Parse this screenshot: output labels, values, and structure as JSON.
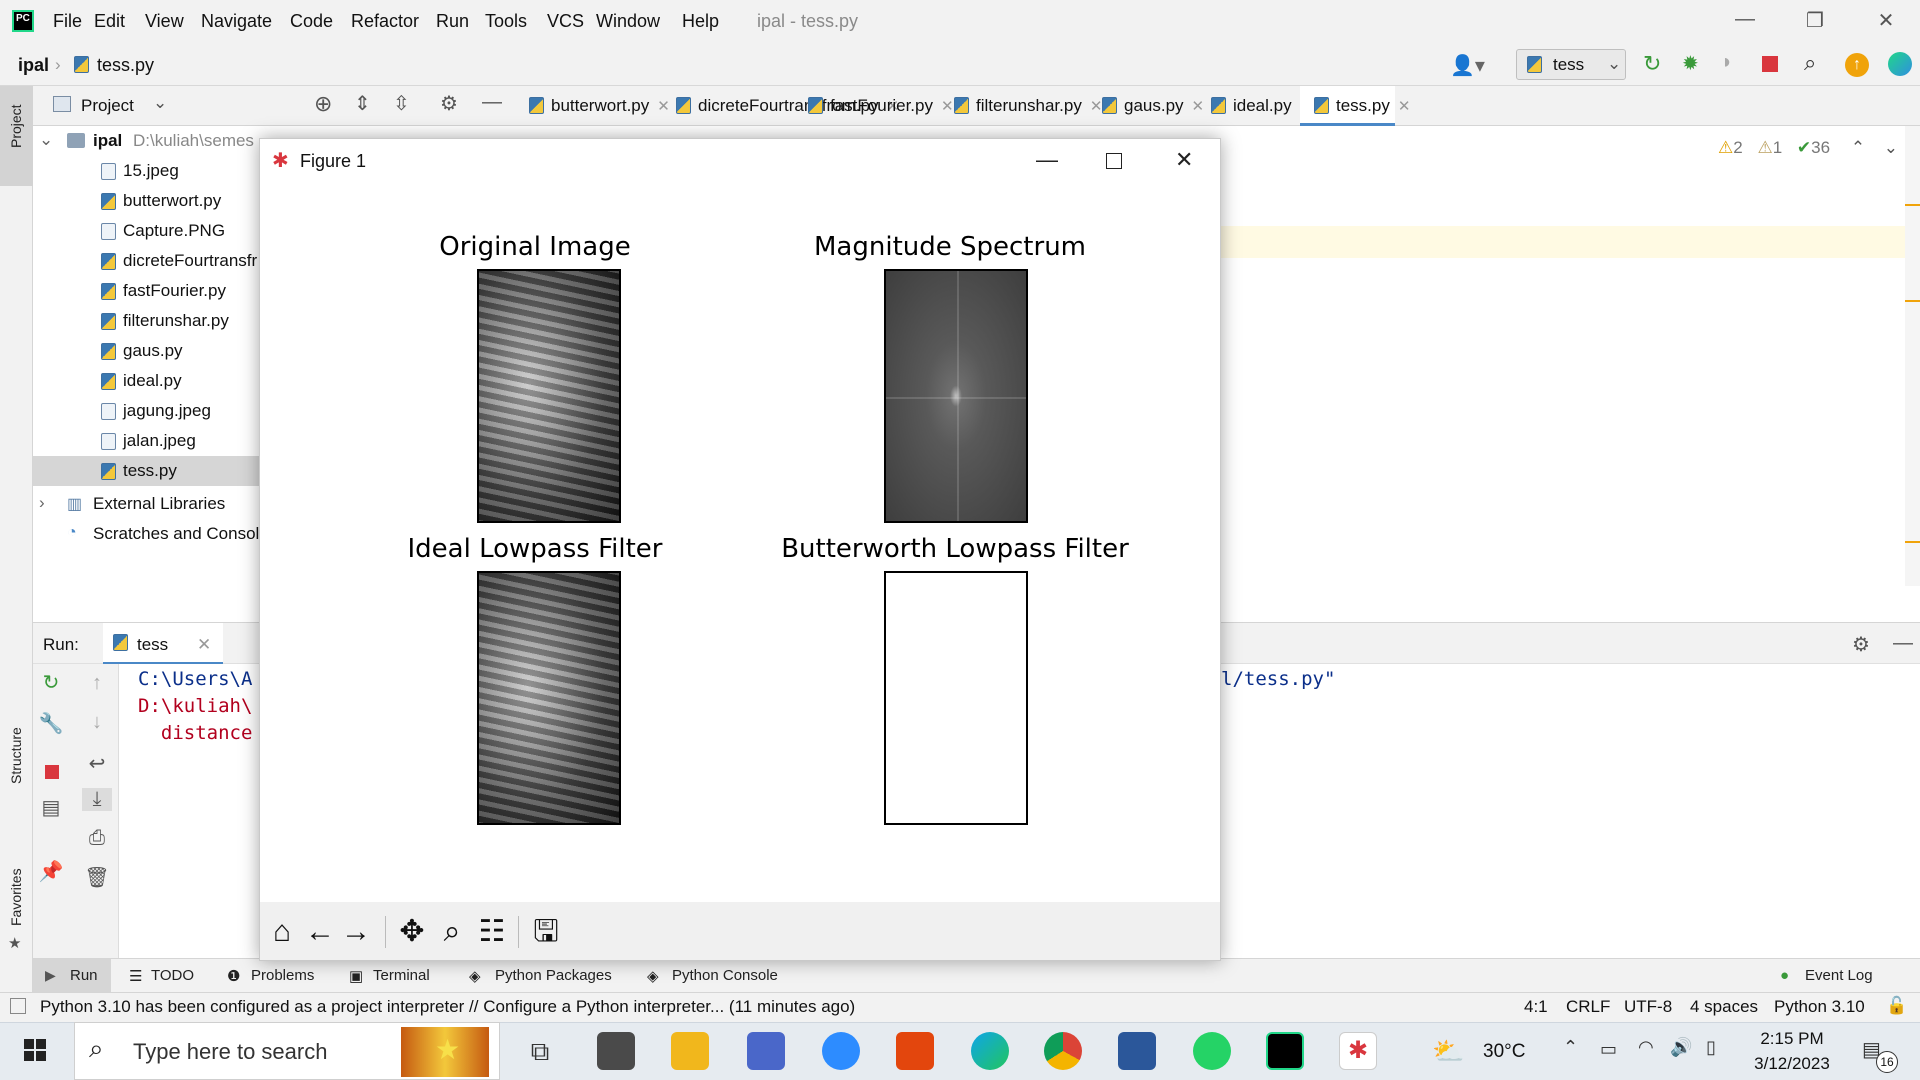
{
  "menubar": {
    "items": [
      "File",
      "Edit",
      "View",
      "Navigate",
      "Code",
      "Refactor",
      "Run",
      "Tools",
      "VCS",
      "Window",
      "Help"
    ],
    "window_title": "ipal - tess.py"
  },
  "navbar": {
    "project": "ipal",
    "file": "tess.py",
    "run_config": "tess"
  },
  "project_panel": {
    "title": "Project",
    "root_name": "ipal",
    "root_path": "D:\\kuliah\\semes",
    "files": [
      {
        "name": "15.jpeg",
        "type": "img"
      },
      {
        "name": "butterwort.py",
        "type": "py"
      },
      {
        "name": "Capture.PNG",
        "type": "img"
      },
      {
        "name": "dicreteFourtransfr",
        "type": "py"
      },
      {
        "name": "fastFourier.py",
        "type": "py"
      },
      {
        "name": "filterunshar.py",
        "type": "py"
      },
      {
        "name": "gaus.py",
        "type": "py"
      },
      {
        "name": "ideal.py",
        "type": "py"
      },
      {
        "name": "jagung.jpeg",
        "type": "img"
      },
      {
        "name": "jalan.jpeg",
        "type": "img"
      },
      {
        "name": "tess.py",
        "type": "py"
      }
    ],
    "external_libraries": "External Libraries",
    "scratches": "Scratches and Consol"
  },
  "editor_tabs": [
    {
      "label": "butterwort.py"
    },
    {
      "label": "dicreteFourtransfrom.py"
    },
    {
      "label": "fastFourier.py"
    },
    {
      "label": "filterunshar.py"
    },
    {
      "label": "gaus.py"
    },
    {
      "label": "ideal.py"
    },
    {
      "label": "tess.py",
      "active": true
    }
  ],
  "inspections": {
    "warnings": "2",
    "weak": "1",
    "ok": "36"
  },
  "side_labels": {
    "project": "Project",
    "structure": "Structure",
    "favorites": "Favorites"
  },
  "run_panel": {
    "label": "Run:",
    "tab": "tess",
    "lines": [
      {
        "text": "C:\\Users\\A",
        "color": "#0b2f8a"
      },
      {
        "text": "D:\\kuliah\\",
        "color": "#b2001e"
      },
      {
        "text": "  distance",
        "color": "#b2001e"
      }
    ],
    "line_tail": "l/tess.py\""
  },
  "bottom_tabs": [
    "Run",
    "TODO",
    "Problems",
    "Terminal",
    "Python Packages",
    "Python Console"
  ],
  "event_log": "Event Log",
  "status": {
    "message": "Python 3.10 has been configured as a project interpreter // Configure a Python interpreter... (11 minutes ago)",
    "position": "4:1",
    "line_sep": "CRLF",
    "encoding": "UTF-8",
    "indent": "4 spaces",
    "interpreter": "Python 3.10"
  },
  "taskbar": {
    "search_placeholder": "Type here to search",
    "weather": "30°C",
    "time": "2:15 PM",
    "date": "3/12/2023",
    "notifications": "16"
  },
  "figure": {
    "window_title": "Figure 1",
    "subplots": [
      {
        "title": "Original Image",
        "kind": "photo"
      },
      {
        "title": "Magnitude Spectrum",
        "kind": "spectrum"
      },
      {
        "title": "Ideal Lowpass Filter",
        "kind": "photo"
      },
      {
        "title": "Butterworth Lowpass Filter",
        "kind": "blank"
      }
    ],
    "toolbar": [
      "home-icon",
      "back-icon",
      "forward-icon",
      "pan-icon",
      "zoom-icon",
      "configure-icon",
      "save-icon"
    ]
  }
}
